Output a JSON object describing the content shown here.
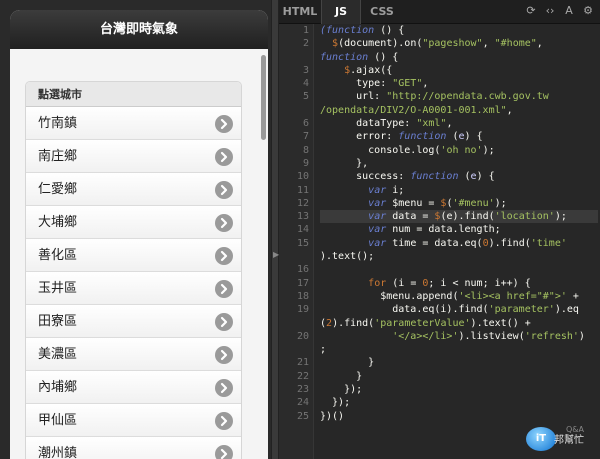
{
  "preview": {
    "header_title": "台灣即時氣象",
    "list_divider": "點選城市",
    "items": [
      "竹南鎮",
      "南庄鄉",
      "仁愛鄉",
      "大埔鄉",
      "善化區",
      "玉井區",
      "田寮區",
      "美濃區",
      "內埔鄉",
      "甲仙區",
      "潮州鎮"
    ]
  },
  "tabs": [
    {
      "label": "HTML",
      "active": false
    },
    {
      "label": "JS",
      "active": true
    },
    {
      "label": "CSS",
      "active": false
    }
  ],
  "tab_icons": [
    "refresh-icon",
    "code-icon",
    "text-size-icon",
    "gear-icon"
  ],
  "code_lines": [
    {
      "n": "1",
      "hl": false,
      "html": "<span class=\"kw\">(function</span> () {"
    },
    {
      "n": "2",
      "hl": false,
      "html": "  <span class=\"o\">$</span>(document).on(<span class=\"s\">\"pageshow\"</span>, <span class=\"s\">\"#home\"</span>,"
    },
    {
      "n": "",
      "hl": false,
      "html": "<span class=\"kw\">function</span> () {"
    },
    {
      "n": "3",
      "hl": false,
      "html": "    <span class=\"o\">$</span>.ajax({"
    },
    {
      "n": "4",
      "hl": false,
      "html": "      type: <span class=\"s\">\"GET\"</span>,"
    },
    {
      "n": "5",
      "hl": false,
      "html": "      url: <span class=\"s\">\"http://opendata.cwb.gov.tw</span>"
    },
    {
      "n": "",
      "hl": false,
      "html": "<span class=\"s\">/opendata/DIV2/O-A0001-001.xml\"</span>,"
    },
    {
      "n": "6",
      "hl": false,
      "html": "      dataType: <span class=\"s\">\"xml\"</span>,"
    },
    {
      "n": "7",
      "hl": false,
      "html": "      error: <span class=\"kw\">function</span> (<span class=\"v\">e</span>) {"
    },
    {
      "n": "8",
      "hl": false,
      "html": "        console.log(<span class=\"s\">'oh no'</span>);"
    },
    {
      "n": "9",
      "hl": false,
      "html": "      },"
    },
    {
      "n": "10",
      "hl": false,
      "html": "      success: <span class=\"kw\">function</span> (<span class=\"v\">e</span>) {"
    },
    {
      "n": "11",
      "hl": false,
      "html": "        <span class=\"kw\">var</span> i;"
    },
    {
      "n": "12",
      "hl": false,
      "html": "        <span class=\"kw\">var</span> $menu = <span class=\"o\">$</span>(<span class=\"s\">'#menu'</span>);"
    },
    {
      "n": "13",
      "hl": true,
      "html": "        <span class=\"kw\">var</span> data = <span class=\"o\">$</span>(e).find(<span class=\"s\">'location'</span>);"
    },
    {
      "n": "14",
      "hl": false,
      "html": "        <span class=\"kw\">var</span> num = data.length;"
    },
    {
      "n": "15",
      "hl": false,
      "html": "        <span class=\"kw\">var</span> time = data.eq(<span class=\"n\">0</span>).find(<span class=\"s\">'time'</span>"
    },
    {
      "n": "",
      "hl": false,
      "html": ").text();"
    },
    {
      "n": "16",
      "hl": false,
      "html": ""
    },
    {
      "n": "17",
      "hl": false,
      "html": "        <span class=\"k\">for</span> (i = <span class=\"n\">0</span>; i &lt; num; i++) {"
    },
    {
      "n": "18",
      "hl": false,
      "html": "          $menu.append(<span class=\"s\">'&lt;li&gt;&lt;a href=\"#\"&gt;'</span> +"
    },
    {
      "n": "19",
      "hl": false,
      "html": "            data.eq(i).find(<span class=\"s\">'parameter'</span>).eq"
    },
    {
      "n": "",
      "hl": false,
      "html": "(<span class=\"n\">2</span>).find(<span class=\"s\">'parameterValue'</span>).text() +"
    },
    {
      "n": "20",
      "hl": false,
      "html": "            <span class=\"s\">'&lt;/a&gt;&lt;/li&gt;'</span>).listview(<span class=\"s\">'refresh'</span>)"
    },
    {
      "n": "",
      "hl": false,
      "html": ";"
    },
    {
      "n": "21",
      "hl": false,
      "html": "        }"
    },
    {
      "n": "22",
      "hl": false,
      "html": "      }"
    },
    {
      "n": "23",
      "hl": false,
      "html": "    });"
    },
    {
      "n": "24",
      "hl": false,
      "html": "  });"
    },
    {
      "n": "25",
      "hl": false,
      "html": "})()"
    }
  ],
  "watermark": {
    "badge": "iT",
    "text": "邦幫忙",
    "sub": "Q&A"
  }
}
